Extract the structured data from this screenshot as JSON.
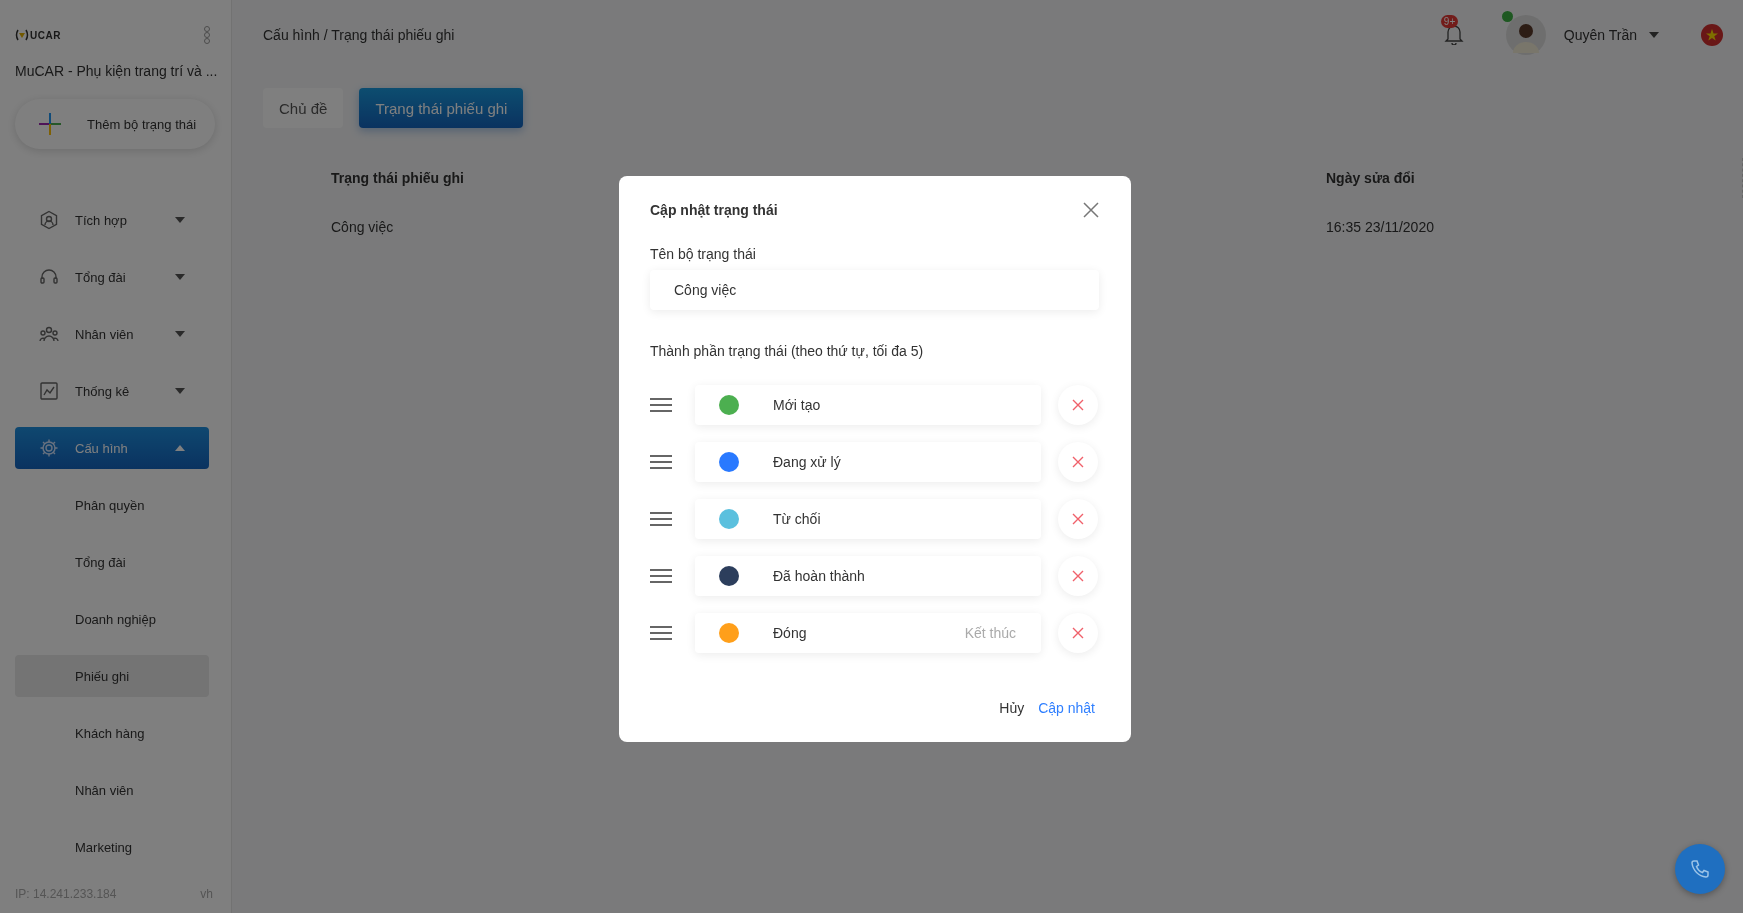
{
  "sidebar": {
    "logo": "UCAR",
    "company": "MuCAR - Phụ kiện trang trí và ...",
    "add_button": "Thêm bộ trạng thái",
    "menu": [
      {
        "label": "Tích hợp",
        "expanded": false,
        "selected": false
      },
      {
        "label": "Tổng đài",
        "expanded": false,
        "selected": false
      },
      {
        "label": "Nhân viên",
        "expanded": false,
        "selected": false
      },
      {
        "label": "Thống kê",
        "expanded": false,
        "selected": false
      },
      {
        "label": "Cấu hình",
        "expanded": true,
        "selected": true,
        "children": [
          {
            "label": "Phân quyền",
            "selected": false
          },
          {
            "label": "Tổng đài",
            "selected": false
          },
          {
            "label": "Doanh nghiệp",
            "selected": false
          },
          {
            "label": "Phiếu ghi",
            "selected": true
          },
          {
            "label": "Khách hàng",
            "selected": false
          },
          {
            "label": "Nhân viên",
            "selected": false
          },
          {
            "label": "Marketing",
            "selected": false
          }
        ]
      }
    ],
    "ip": "IP: 14.241.233.184",
    "lang": "vh"
  },
  "header": {
    "breadcrumb": "Cấu hình / Trạng thái phiếu ghi",
    "notification_badge": "9+",
    "user": {
      "name": "Quyên Trần",
      "online": true
    }
  },
  "tabs": [
    {
      "label": "Chủ đề",
      "selected": false
    },
    {
      "label": "Trạng thái phiếu ghi",
      "selected": true
    }
  ],
  "table": {
    "columns": [
      "Trạng thái phiếu ghi",
      "Ngày sửa đổi"
    ],
    "rows": [
      [
        "Công việc",
        "16:35 23/11/2020"
      ]
    ]
  },
  "dialog": {
    "title": "Cập nhật trạng thái",
    "name_label": "Tên bộ trạng thái",
    "name_value": "Công việc",
    "statuses_label": "Thành phần trạng thái (theo thứ tự, tối đa 5)",
    "statuses": [
      {
        "name": "Mới tạo",
        "color": "#4caf50"
      },
      {
        "name": "Đang xử lý",
        "color": "#2979ff"
      },
      {
        "name": "Từ chối",
        "color": "#5bc0de"
      },
      {
        "name": "Đã hoàn thành",
        "color": "#2c3e5c"
      },
      {
        "name": "Đóng",
        "color": "#ff9f1a",
        "note": "Kết thúc"
      }
    ],
    "cancel": "Hủy",
    "confirm": "Cập nhật"
  }
}
